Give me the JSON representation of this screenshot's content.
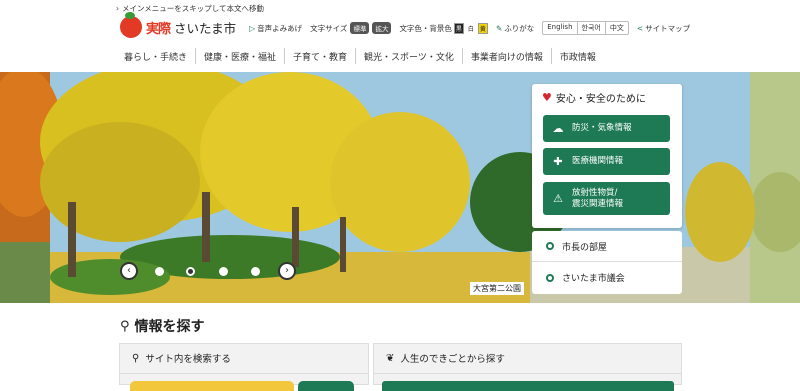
{
  "skip_link": "メインメニューをスキップして本文へ移動",
  "logo": {
    "brand": "実際",
    "city": "さいたま市"
  },
  "utilities": {
    "voice": "音声よみあげ",
    "text_size": "文字サイズ",
    "size_standard": "標準",
    "size_large": "拡大",
    "color": "文字色・背景色",
    "color_black": "黒",
    "color_white": "白",
    "color_yellow": "黄",
    "furigana": "ふりがな",
    "languages": [
      "English",
      "한국어",
      "中文"
    ],
    "sitemap": "サイトマップ"
  },
  "nav": [
    "暮らし・手続き",
    "健康・医療・福祉",
    "子育て・教育",
    "観光・スポーツ・文化",
    "事業者向けの情報",
    "市政情報"
  ],
  "hero": {
    "caption": "大宮第二公園",
    "prev": "‹",
    "next": "›"
  },
  "safety": {
    "title": "安心・安全のために",
    "buttons": [
      {
        "icon": "cloud-sun-icon",
        "label": "防災・気象情報"
      },
      {
        "icon": "cross-icon",
        "label": "医療機関情報"
      },
      {
        "icon": "warning-icon",
        "label_line1": "放射性物質/",
        "label_line2": "震災関連情報"
      }
    ]
  },
  "links": [
    "市長の部屋",
    "さいたま市議会"
  ],
  "info": {
    "heading": "情報を探す",
    "site_search": "サイト内を検索する",
    "life_events": "人生のできごとから探す"
  },
  "colors": {
    "accent_green": "#1e7a55",
    "heart_red": "#d6262d",
    "yellow": "#f2c73c"
  }
}
